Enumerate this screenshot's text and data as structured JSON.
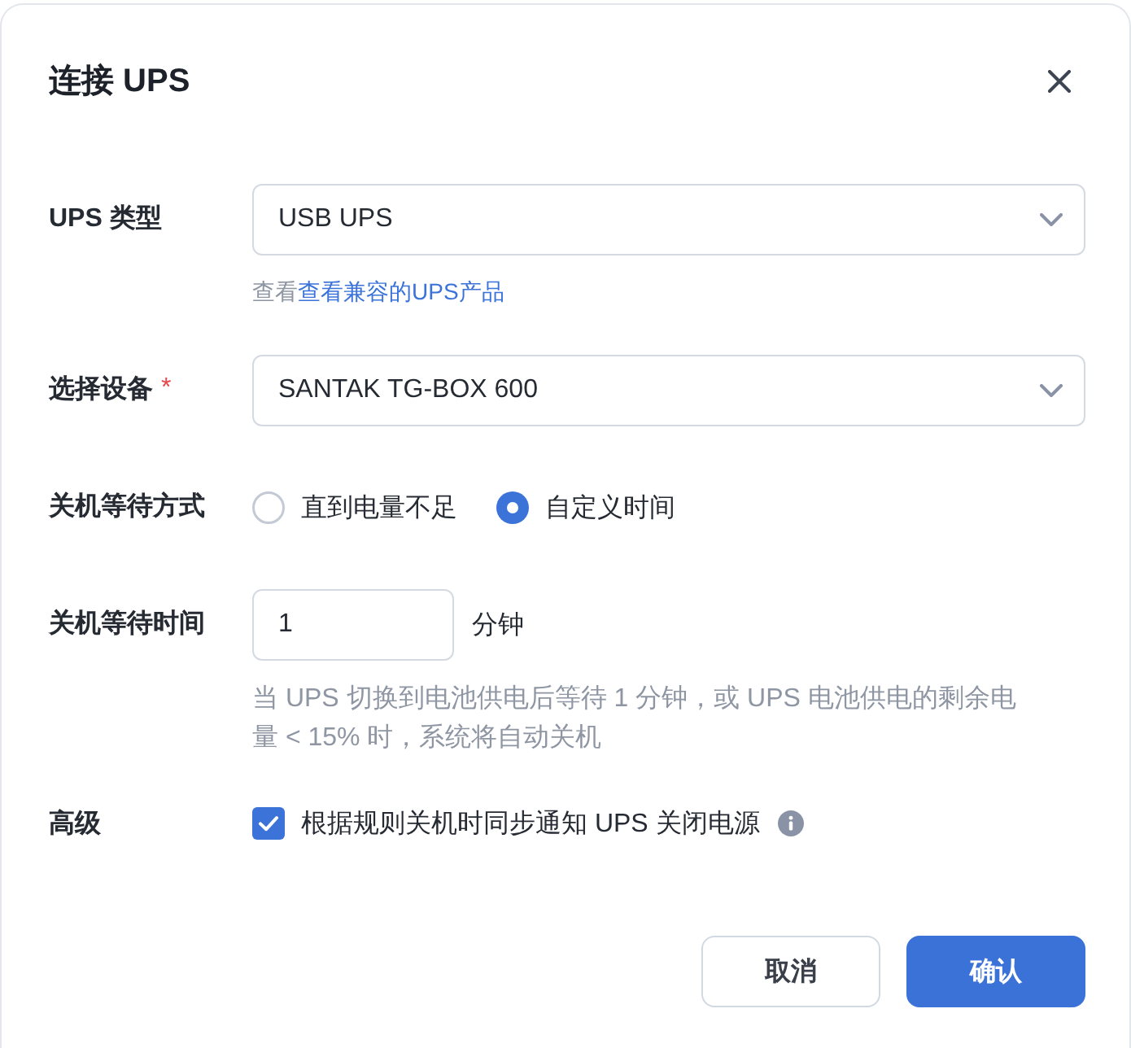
{
  "dialog": {
    "title": "连接 UPS"
  },
  "fields": [
    {
      "kind": "select",
      "label": "UPS 类型",
      "value": "USB UPS",
      "help": {
        "prefix": "查看",
        "link": "查看兼容的UPS产品"
      }
    },
    {
      "kind": "select",
      "label": "选择设备",
      "required_mark": "*",
      "value": "SANTAK TG-BOX 600"
    },
    {
      "kind": "radio",
      "label": "关机等待方式",
      "options": [
        {
          "label": "直到电量不足",
          "selected": false
        },
        {
          "label": "自定义时间",
          "selected": true
        }
      ]
    },
    {
      "kind": "number",
      "label": "关机等待时间",
      "value": "1",
      "unit": "分钟",
      "hint": "当 UPS 切换到电池供电后等待 1 分钟，或 UPS 电池供电的剩余电量 < 15% 时，系统将自动关机"
    },
    {
      "kind": "checkbox",
      "label": "高级",
      "checked": true,
      "text": "根据规则关机时同步通知 UPS 关闭电源"
    }
  ],
  "buttons": [
    {
      "kind": "secondary",
      "label": "取消"
    },
    {
      "kind": "primary",
      "label": "确认"
    }
  ]
}
